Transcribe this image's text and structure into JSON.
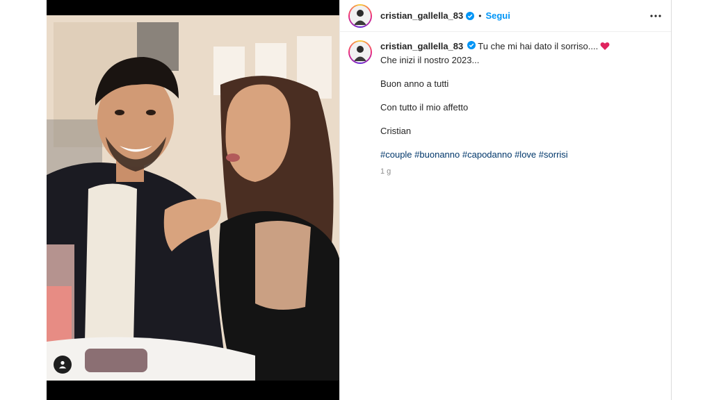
{
  "post": {
    "username": "cristian_gallella_83",
    "follow_label": "Segui",
    "separator": "•",
    "caption": {
      "line1": "Tu che mi hai dato il sorriso....",
      "line2": "Che inizi il nostro 2023...",
      "line3": "Buon anno a tutti",
      "line4": "Con tutto il mio affetto",
      "line5": "Cristian"
    },
    "hashtags": [
      "#couple",
      "#buonanno",
      "#capodanno",
      "#love",
      "#sorrisi"
    ],
    "time": "1 g"
  },
  "icons": {
    "verified": "verified-badge-icon",
    "heart": "red-heart-emoji",
    "more": "more-options-icon",
    "tag": "user-tag-icon"
  },
  "colors": {
    "link": "#0095f6",
    "hashtag": "#00376b",
    "verified": "#0095f6",
    "heart": "#e0245e"
  }
}
